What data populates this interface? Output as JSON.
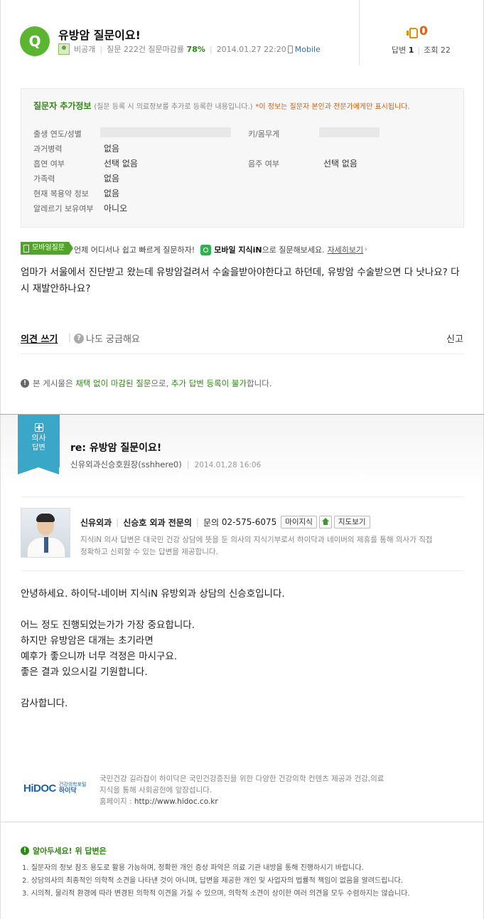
{
  "question": {
    "badge": "Q",
    "title": "유방암 질문이요!",
    "author": "비공개",
    "stats_text": "질문 222건 질문마감률",
    "close_rate": "78%",
    "datetime": "2014.01.27 22:20",
    "device": "Mobile",
    "likes": "0",
    "answers_label": "답변",
    "answers_count": "1",
    "views_label": "조회",
    "views_count": "22"
  },
  "info": {
    "title": "질문자 추가정보",
    "desc": "(질문 등록 시 의료정보를 추가로 등록한 내용입니다.)",
    "warning": "*이 정보는 질문자 본인과 전문가에게만 표시됩니다.",
    "rows": [
      {
        "label": "출생 연도/성별",
        "value": ""
      },
      {
        "label": "과거병력",
        "value": "없음"
      },
      {
        "label": "흡연 여부",
        "value": "선택 없음"
      },
      {
        "label": "가족력",
        "value": "없음"
      },
      {
        "label": "현재 복용약 정보",
        "value": "없음"
      },
      {
        "label": "알레르기 보유여부",
        "value": "아니오"
      }
    ],
    "right_rows": [
      {
        "label": "키/몸무게",
        "value": ""
      },
      {
        "label": "음주 여부",
        "value": "선택 없음"
      }
    ]
  },
  "promo": {
    "tag": "모바일질문",
    "text1": "언제 어디서나 쉽고 빠르게 질문하자!",
    "app_name": "모바일 지식iN",
    "text2": "으로 질문해보세요.",
    "link": "자세히보기",
    "link_arrow": "›"
  },
  "question_body": "엄마가 서울에서 진단받고 왔는데 유방암걸려서 수술을받아야한다고 하던데, 유방암 수술받으면 다 낫나요? 다시 재발안하나요?",
  "actions": {
    "write": "의견 쓰기",
    "sep": "|",
    "curious": "나도 궁금해요",
    "curious_icon": "?",
    "report": "신고"
  },
  "notice": {
    "icon": "!",
    "p1": "본 게시물은",
    "g1": "채택 없이 마감된 질문",
    "p2": "으로,",
    "g2": "추가 답변 등록이 불가",
    "p3": "합니다."
  },
  "answer": {
    "ribbon_line1": "의사",
    "ribbon_line2": "답변",
    "title": "re: 유방암 질문이요!",
    "author": "신유외과신승호원장(sshhere0)",
    "datetime": "2014.01.28 16:06",
    "doctor": {
      "clinic": "신유외과",
      "name": "신승호 외과 전문의",
      "contact_label": "문의",
      "phone": "02-575-6075",
      "btn_myknow": "마이지식",
      "btn_map": "지도보기",
      "desc": "지식iN 의사 답변은 대국민 건강 상담에 뜻을 둔 의사의 지식기부로서 하이닥과 네이버의 제휴를 통해 의사가 직접 정확하고 신뢰할 수 있는 답변을 제공합니다."
    },
    "body": "안녕하세요. 하이닥-네이버 지식iN 유방외과 상담의 신승호입니다.\n\n어느 정도 진행되었는가가 가장 중요합니다.\n하지만 유방암은 대개는 초기라면\n예후가 좋으니까 너무 걱정은 마시구요.\n좋은 결과 있으시길 기원합니다.\n\n감사합니다."
  },
  "hidoc": {
    "logo_main": "HiDOC",
    "logo_sub_small": "건강의학포털",
    "logo_sub": "하이닥",
    "desc": "국민건강 길라잡이 하이닥은 국민건강증진을 위한 다양한 건강의학 컨텐츠 제공과 건강,의료 지식을 통해 사회공헌에 앞장섭니다.",
    "homepage_label": "홈페이지 :",
    "homepage": "http://www.hidoc.co.kr"
  },
  "notes": {
    "icon": "!",
    "title": "알아두세요! 위 답변은",
    "items": [
      "1.  질문자의 정보 참조 용도로 활용 가능하며, 정확한 개인 증상 파악은 의료 기관 내방을 통해 진행하시기 바랍니다.",
      "2.  상담의사의 최종적인 의학적 소견을 나타낸 것이 아니며, 답변을 제공한 개인 및 사업자의 법률적 책임이 없음을 알려드립니다.",
      "3.  시의적, 물리적 환경에 따라 변경된 의학적 이견을 가질 수 있으며, 의학적 소견이 상이한 여러 의견을 모두 수렴하지는 않습니다."
    ]
  },
  "colors": {
    "accent_green": "#5cb531",
    "text_green": "#2c8a10",
    "warn_orange": "#e05a00",
    "ribbon_blue": "#3aa6c8"
  }
}
